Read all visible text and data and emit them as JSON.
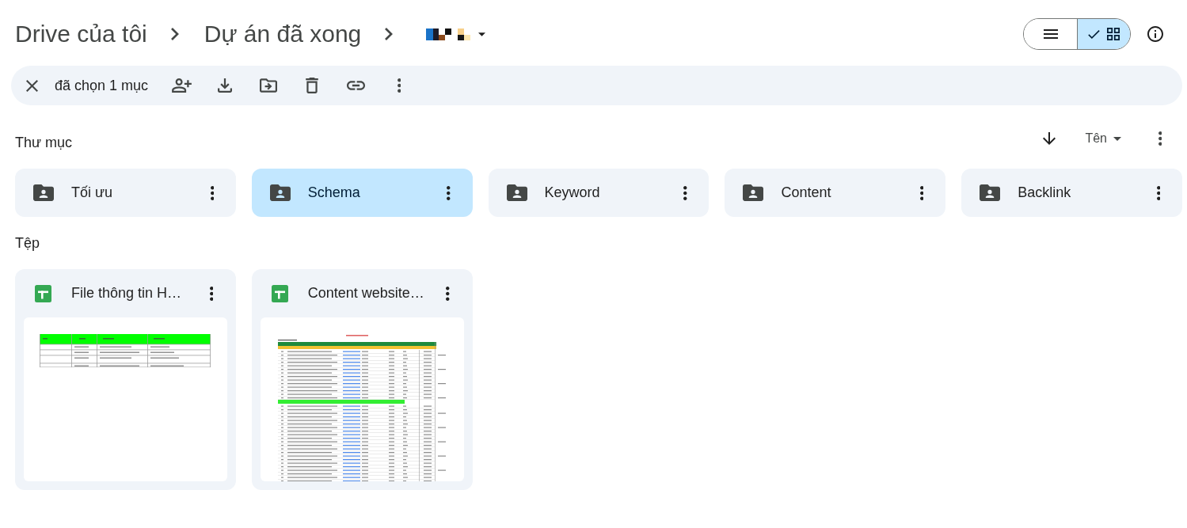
{
  "breadcrumb": [
    "Drive của tôi",
    "Dự án đã xong"
  ],
  "view_toggle": [
    {
      "kind": "list",
      "selected": false
    },
    {
      "kind": "grid",
      "selected": true
    }
  ],
  "selection_bar": {
    "label": "đã chọn 1 mục"
  },
  "folders": {
    "title": "Thư mục",
    "sort": {
      "label": "Tên"
    },
    "items": [
      {
        "name": "Tối ưu",
        "selected": false
      },
      {
        "name": "Schema",
        "selected": true
      },
      {
        "name": "Keyword",
        "selected": false
      },
      {
        "name": "Content",
        "selected": false
      },
      {
        "name": "Backlink",
        "selected": false
      }
    ]
  },
  "files": {
    "title": "Tệp",
    "items": [
      {
        "name": "File thông tin H…",
        "kind": "spreadsheet",
        "preview": {
          "kind": "short_table"
        },
        "selected": false
      },
      {
        "name": "Content website…",
        "kind": "spreadsheet",
        "preview": {
          "kind": "long_table"
        },
        "selected": false
      }
    ]
  }
}
